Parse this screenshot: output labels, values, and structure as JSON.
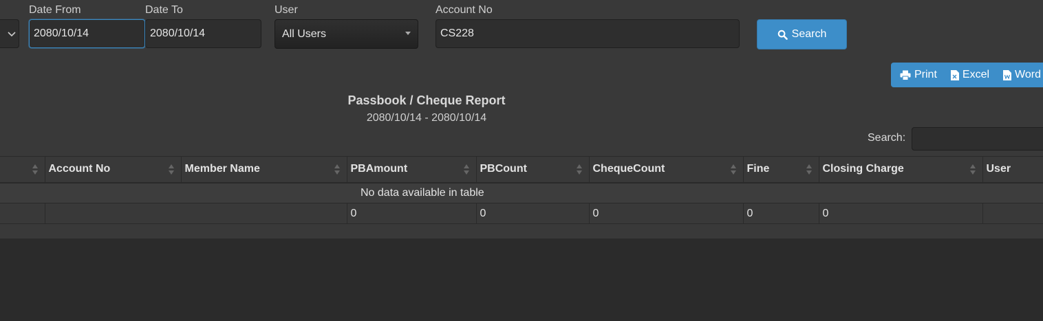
{
  "filters": {
    "date_from_label": "Date From",
    "date_from_value": "2080/10/14",
    "date_to_label": "Date To",
    "date_to_value": "2080/10/14",
    "user_label": "User",
    "user_value": "All Users",
    "account_label": "Account No",
    "account_value": "CS228",
    "search_button": "Search"
  },
  "export": {
    "print": "Print",
    "excel": "Excel",
    "word": "Word"
  },
  "report": {
    "title": "Passbook / Cheque Report",
    "range": "2080/10/14 - 2080/10/14"
  },
  "table_search_label": "Search:",
  "table": {
    "columns": [
      "",
      "Account No",
      "Member Name",
      "PBAmount",
      "PBCount",
      "ChequeCount",
      "Fine",
      "Closing Charge",
      "User"
    ],
    "empty_message": "No data available in table",
    "totals": [
      "",
      "",
      "",
      "0",
      "0",
      "0",
      "0",
      "0",
      ""
    ]
  },
  "colors": {
    "accent": "#3d8ec9",
    "panel": "#393939",
    "background": "#2b2b2b"
  }
}
